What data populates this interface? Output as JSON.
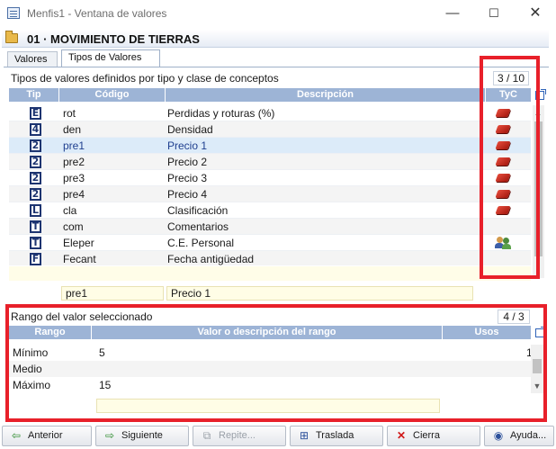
{
  "window": {
    "title": "Menfis1 - Ventana de valores",
    "minimize_glyph": "—",
    "maximize_glyph": "☐",
    "close_glyph": "✕"
  },
  "header": {
    "title": "01 · MOVIMIENTO DE TIERRAS",
    "icon": "folder-icon"
  },
  "tabs": [
    {
      "label": "Valores",
      "active": false
    },
    {
      "label": "Tipos de Valores",
      "active": true
    }
  ],
  "types_section": {
    "title": "Tipos de valores definidos por tipo y clase de conceptos",
    "counter": "3 / 10",
    "columns": {
      "tip": "Tip",
      "codigo": "Código",
      "descripcion": "Descripción",
      "tyc": "TyC"
    },
    "rows": [
      {
        "tip": "E",
        "code": "rot",
        "desc": "Perdidas y roturas (%)",
        "tyc": "brick-icon"
      },
      {
        "tip": "4",
        "code": "den",
        "desc": "Densidad",
        "tyc": "brick-icon"
      },
      {
        "tip": "2",
        "code": "pre1",
        "desc": "Precio 1",
        "tyc": "brick-icon",
        "selected": true
      },
      {
        "tip": "2",
        "code": "pre2",
        "desc": "Precio 2",
        "tyc": "brick-icon"
      },
      {
        "tip": "2",
        "code": "pre3",
        "desc": "Precio 3",
        "tyc": "brick-icon"
      },
      {
        "tip": "2",
        "code": "pre4",
        "desc": "Precio 4",
        "tyc": "brick-icon"
      },
      {
        "tip": "L",
        "code": "cla",
        "desc": "Clasificación",
        "tyc": "brick-icon"
      },
      {
        "tip": "T",
        "code": "com",
        "desc": "Comentarios",
        "tyc": ""
      },
      {
        "tip": "T",
        "code": "Eleper",
        "desc": "C.E. Personal",
        "tyc": "people-icon"
      },
      {
        "tip": "F",
        "code": "Fecant",
        "desc": "Fecha antigüedad",
        "tyc": ""
      }
    ],
    "edit_code": "pre1",
    "edit_desc": "Precio 1"
  },
  "range_section": {
    "title": "Rango del valor seleccionado",
    "counter": "4 / 3",
    "columns": {
      "rango": "Rango",
      "valor": "Valor o descripción del rango",
      "usos": "Usos"
    },
    "rows": [
      {
        "label": "Mínimo",
        "value": "5",
        "usos": "1"
      },
      {
        "label": "Medio",
        "value": "",
        "usos": ""
      },
      {
        "label": "Máximo",
        "value": "15",
        "usos": ""
      }
    ],
    "edit_value": ""
  },
  "buttons": [
    {
      "label": "Anterior",
      "icon": "arrow-left-icon",
      "enabled": true
    },
    {
      "label": "Siguiente",
      "icon": "arrow-right-icon",
      "enabled": true
    },
    {
      "label": "Repite...",
      "icon": "repeat-icon",
      "enabled": false
    },
    {
      "label": "Traslada",
      "icon": "move-icon",
      "enabled": true
    },
    {
      "label": "Cierra",
      "icon": "close-icon",
      "enabled": true
    },
    {
      "label": "Ayuda...",
      "icon": "help-icon",
      "enabled": true
    }
  ],
  "colors": {
    "header_row": "#9db4d6",
    "selected_row": "#dcebf9",
    "highlight_frame": "#e8202a",
    "brick": "#c0261a"
  }
}
